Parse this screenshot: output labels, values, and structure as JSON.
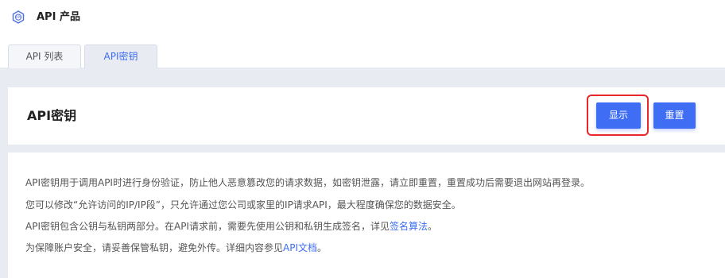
{
  "header": {
    "title": "API 产品",
    "icon": "api-gear-icon"
  },
  "tabs": [
    {
      "label": "API 列表",
      "active": false
    },
    {
      "label": "API密钥",
      "active": true
    }
  ],
  "section": {
    "title": "API密钥",
    "show_label": "显示",
    "reset_label": "重置"
  },
  "description": {
    "line1": "API密钥用于调用API时进行身份验证，防止他人恶意篡改您的请求数据，如密钥泄露，请立即重置，重置成功后需要退出网站再登录。",
    "line2": "您可以修改“允许访问的IP/IP段”，只允许通过您公司或家里的IP请求API，最大程度确保您的数据安全。",
    "line3_prefix": "API密钥包含公钥与私钥两部分。在API请求前，需要先使用公钥和私钥生成签名，详见",
    "line3_link": "签名算法",
    "line3_suffix": "。",
    "line4_prefix": "为保障账户安全，请妥善保管私钥，避免外传。详细内容参见",
    "line4_link": "API文档",
    "line4_suffix": "。"
  },
  "colors": {
    "accent": "#3f6ef5",
    "highlight": "#e8272a",
    "background": "#e9ebf3"
  }
}
